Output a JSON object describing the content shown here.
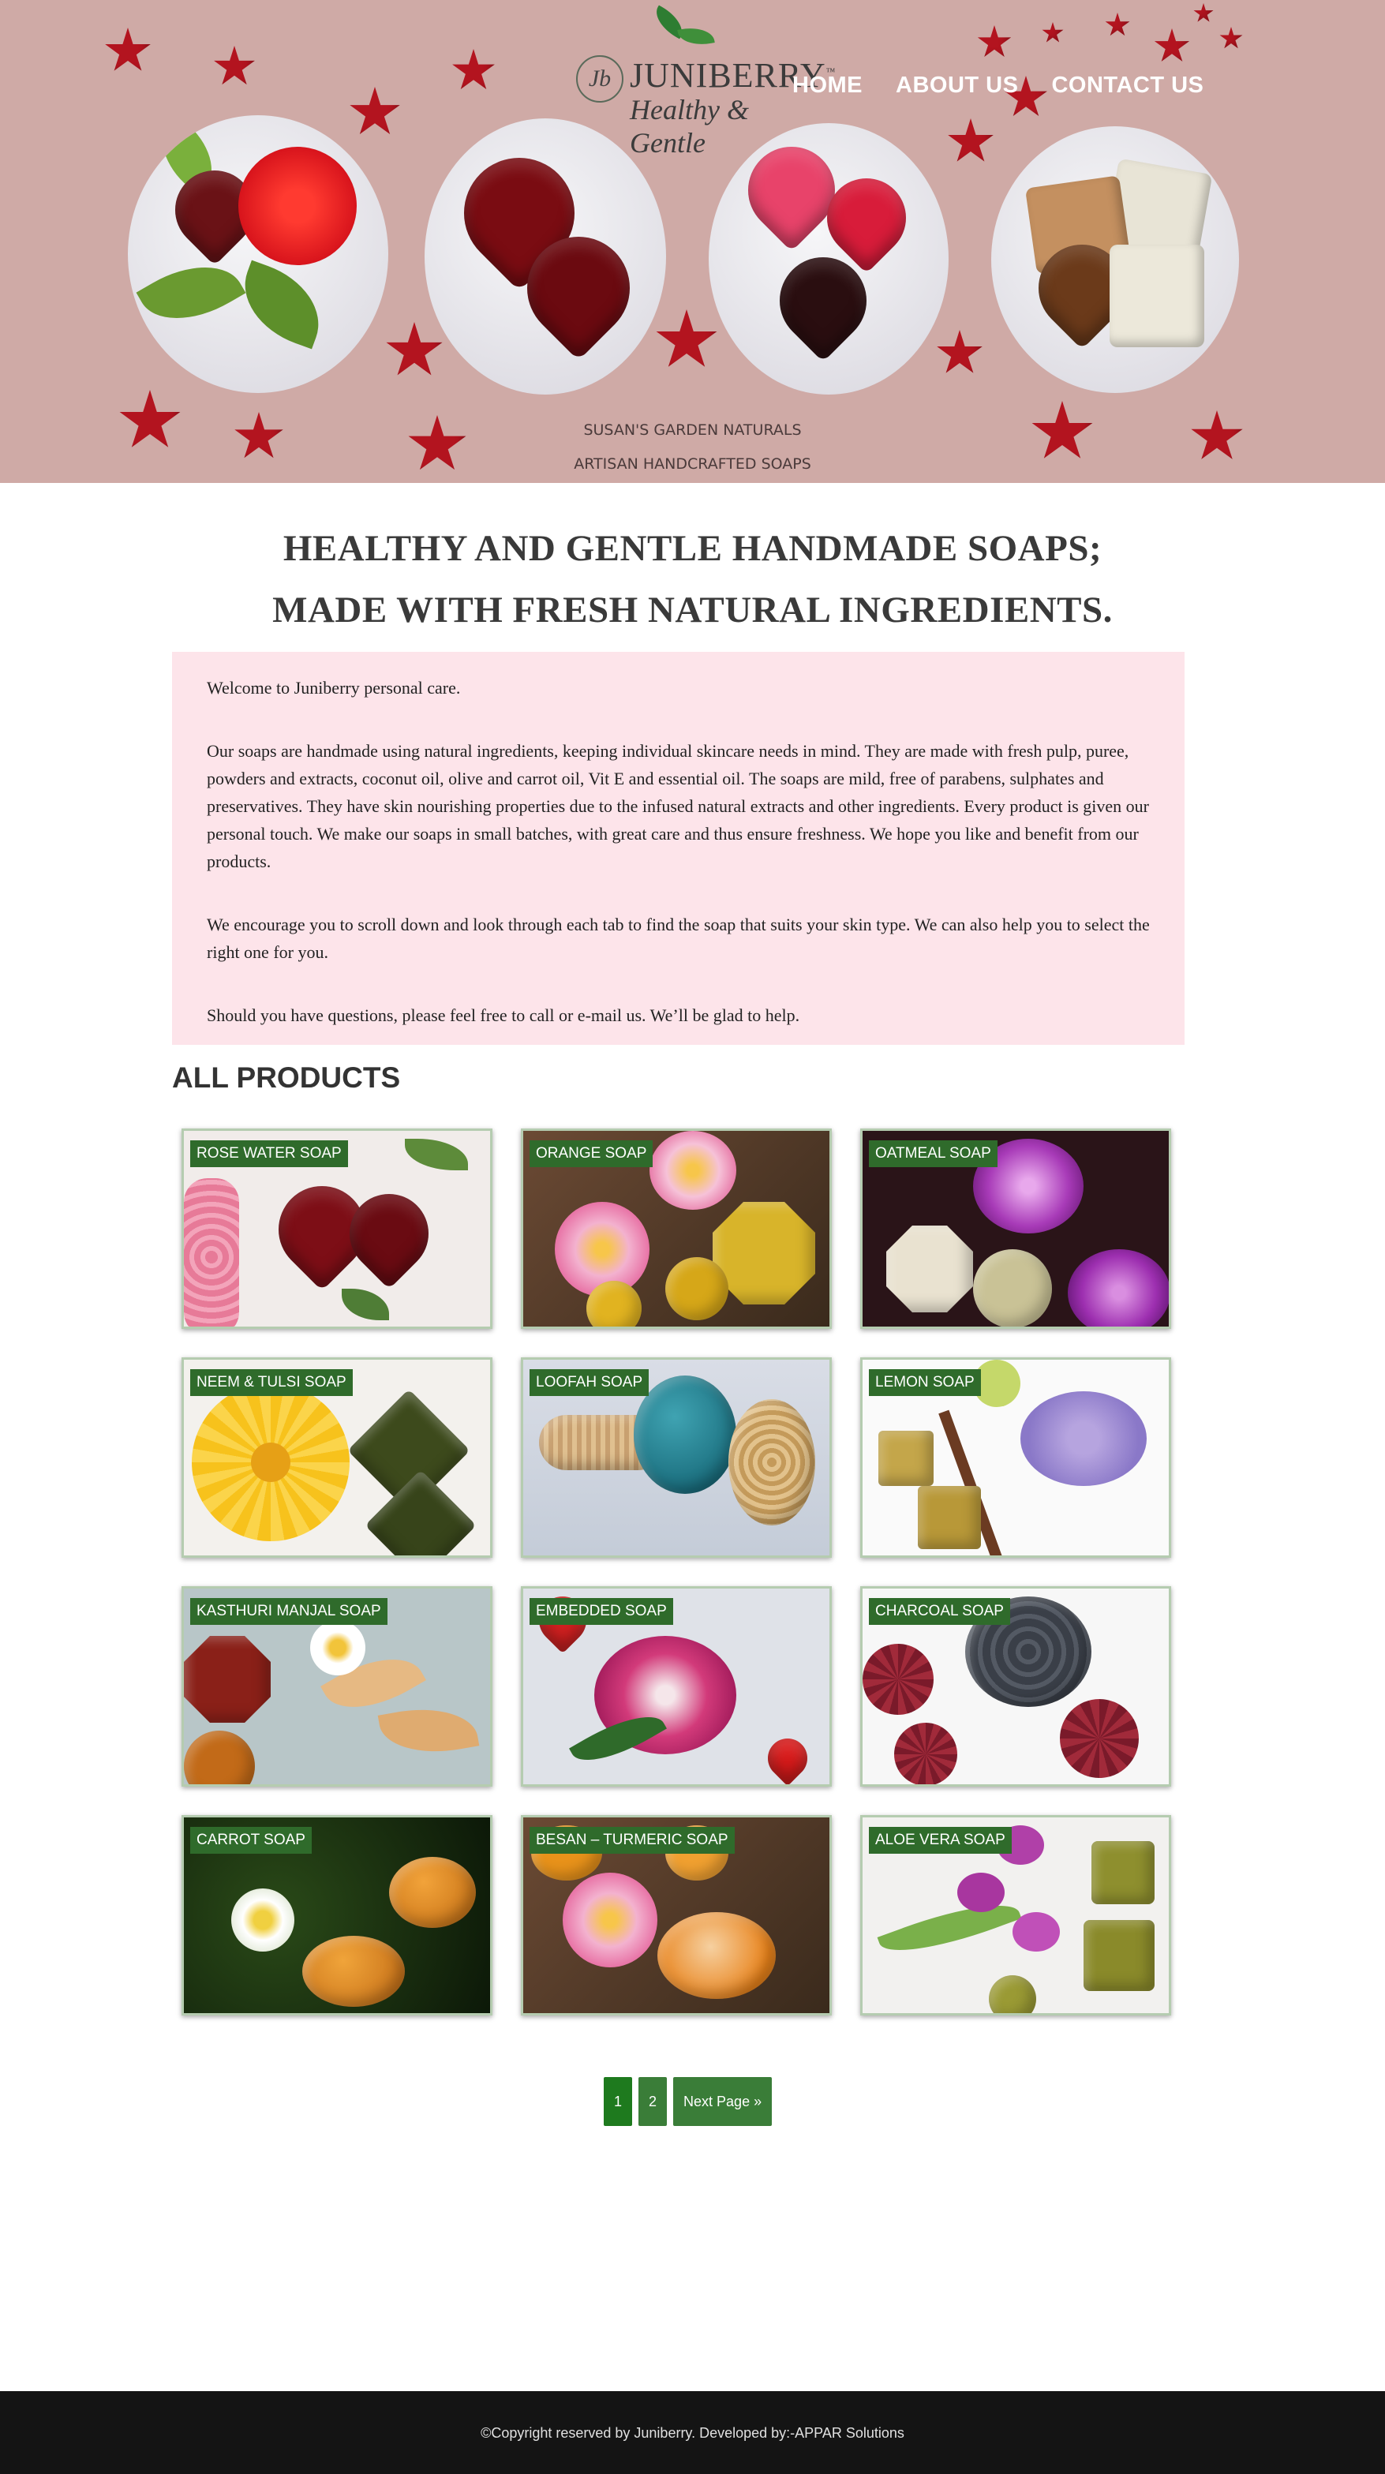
{
  "brand": {
    "monogram": "Jb",
    "name": "JUNIBERRY",
    "tm": "™",
    "tagline": "Healthy & Gentle"
  },
  "nav": {
    "items": [
      {
        "label": "HOME"
      },
      {
        "label": "ABOUT US"
      },
      {
        "label": "CONTACT US"
      }
    ]
  },
  "hero": {
    "line1": "SUSAN'S GARDEN NATURALS",
    "line2": "ARTISAN HANDCRAFTED SOAPS",
    "background_color": "#cfaaa6"
  },
  "intro": {
    "headline_1": "HEALTHY AND GENTLE HANDMADE SOAPS;",
    "headline_2": "MADE WITH FRESH NATURAL INGREDIENTS.",
    "paragraphs": [
      "Welcome to Juniberry personal care.",
      "Our soaps are handmade using natural ingredients, keeping individual skincare needs in mind. They are made with fresh pulp, puree, powders and extracts, coconut oil, olive and carrot oil, Vit E and essential oil. The soaps are mild, free of parabens, sulphates and preservatives. They have skin nourishing properties due to the infused natural extracts and other ingredients. Every product is given our personal touch. We make our soaps in small batches, with great care and thus ensure freshness. We hope you like and benefit from our products.",
      "We encourage you to scroll down and look through each tab to find the soap that suits your skin type. We can also help you to select the right one for you.",
      "Should you have questions, please feel free to call or e-mail us. We’ll be glad to help."
    ],
    "box_color": "#fde4ea"
  },
  "products": {
    "heading": "ALL PRODUCTS",
    "items": [
      {
        "label": "ROSE WATER SOAP"
      },
      {
        "label": "ORANGE SOAP"
      },
      {
        "label": "OATMEAL SOAP"
      },
      {
        "label": "NEEM & TULSI SOAP"
      },
      {
        "label": "LOOFAH SOAP"
      },
      {
        "label": "LEMON SOAP"
      },
      {
        "label": "KASTHURI MANJAL SOAP"
      },
      {
        "label": "EMBEDDED SOAP"
      },
      {
        "label": "CHARCOAL SOAP"
      },
      {
        "label": "CARROT SOAP"
      },
      {
        "label": "BESAN – TURMERIC SOAP"
      },
      {
        "label": "ALOE VERA SOAP"
      }
    ],
    "badge_color": "#2f6b2b"
  },
  "pagination": {
    "page_1": "1",
    "page_2": "2",
    "next": "Next Page »"
  },
  "footer": {
    "text": "©Copyright reserved by Juniberry. Developed by:-APPAR Solutions"
  }
}
